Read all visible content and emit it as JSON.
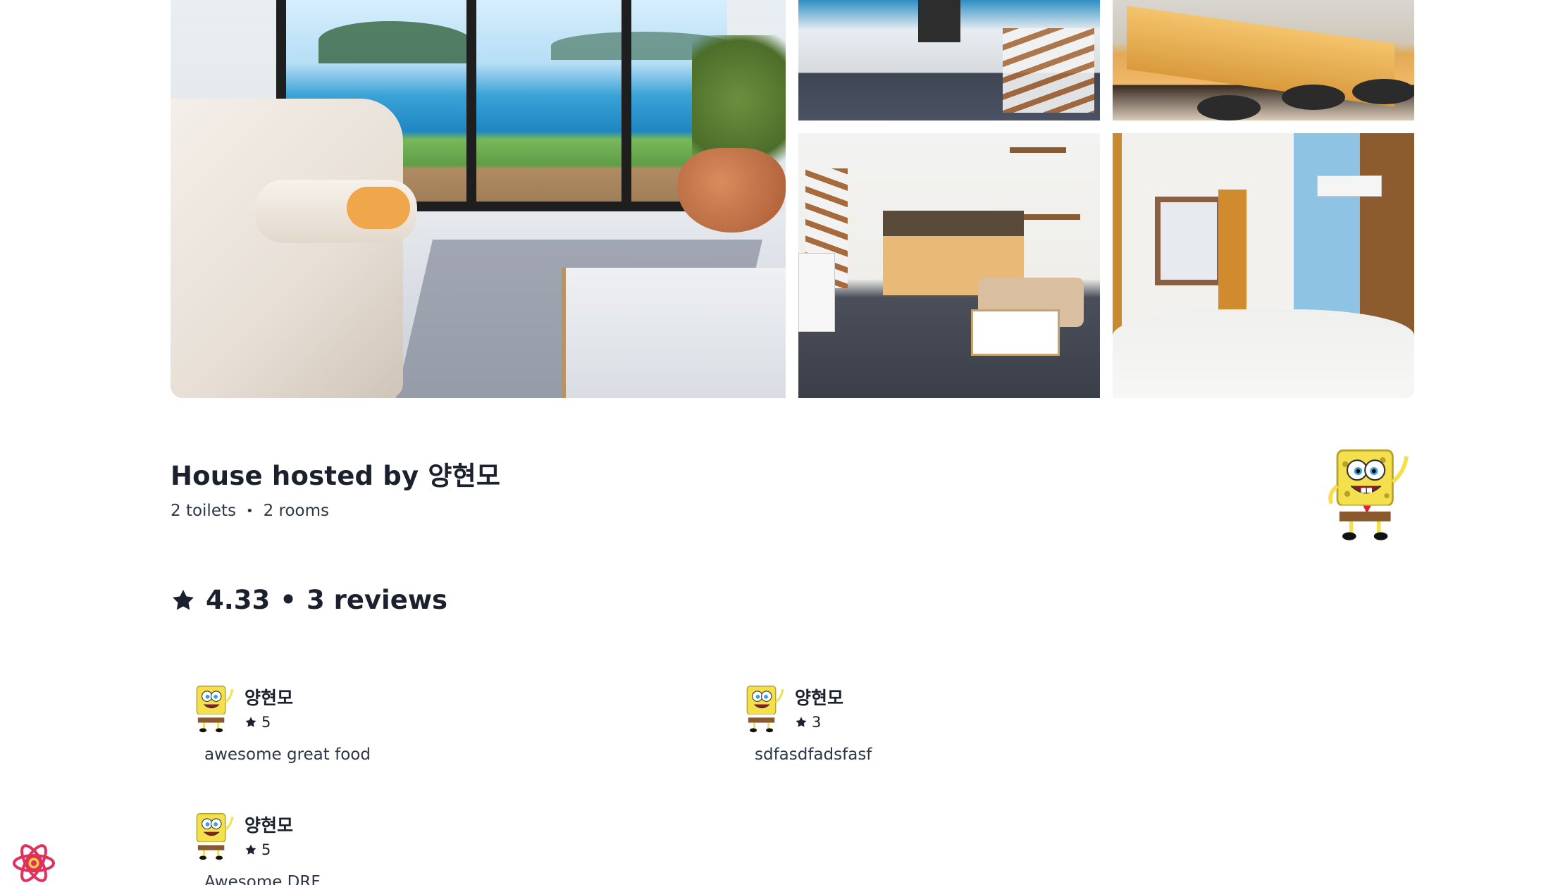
{
  "listing": {
    "title": "House hosted by 양현모",
    "toilets": "2 toilets",
    "separator": "•",
    "rooms": "2 rooms"
  },
  "rating_summary": {
    "rating": "4.33",
    "separator": "•",
    "reviews_label": "3 reviews"
  },
  "reviews": [
    {
      "name": "양현모",
      "stars": "5",
      "text": "awesome great food"
    },
    {
      "name": "양현모",
      "stars": "3",
      "text": "sdfasdfadsfasf"
    },
    {
      "name": "양현모",
      "stars": "5",
      "text": "Awesome DRF"
    }
  ],
  "icons": {
    "star": "star-icon",
    "avatar": "spongebob-avatar",
    "react": "react-logo-icon"
  },
  "colors": {
    "text": "#1a202c",
    "muted": "#2d3748",
    "react": "#e0315a"
  }
}
